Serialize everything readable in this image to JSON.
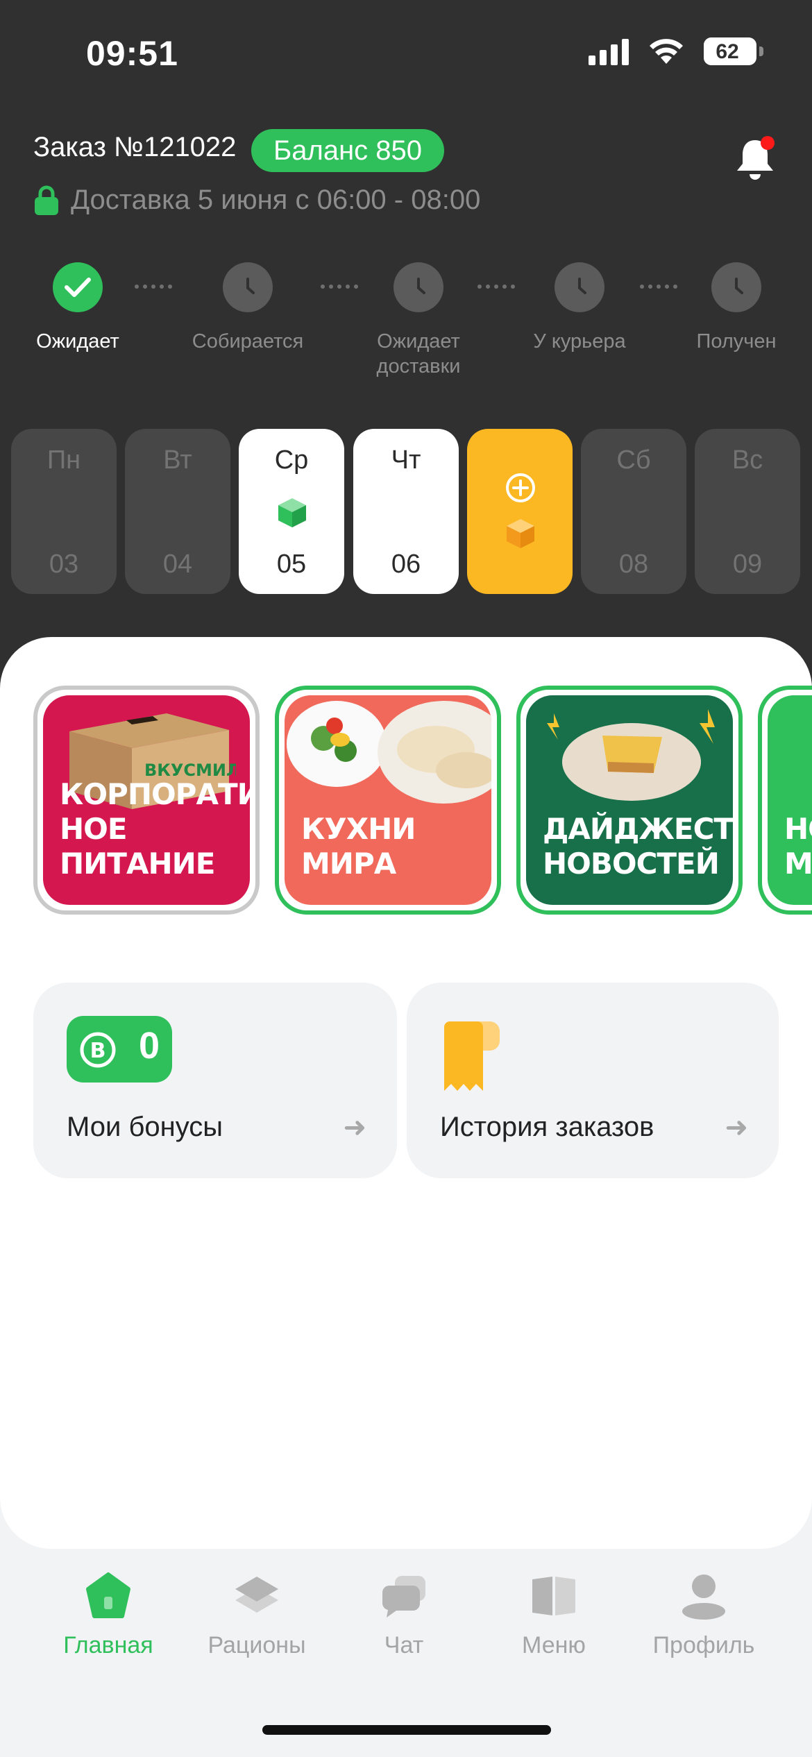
{
  "status_bar": {
    "time": "09:51",
    "battery": "62",
    "battery_level": 0.62
  },
  "header": {
    "order_title": "Заказ №121022",
    "balance": "Баланс 850",
    "delivery": "Доставка 5 июня с 06:00 - 08:00",
    "notification_dot": true
  },
  "tracker": {
    "steps": [
      {
        "label": "Ожидает",
        "state": "done"
      },
      {
        "label": "Собирается",
        "state": "pending"
      },
      {
        "label": "Ожидает доставки",
        "state": "pending"
      },
      {
        "label": "У курьера",
        "state": "pending"
      },
      {
        "label": "Получен",
        "state": "pending"
      }
    ]
  },
  "days": [
    {
      "name": "Пн",
      "num": "03",
      "state": "inactive"
    },
    {
      "name": "Вт",
      "num": "04",
      "state": "inactive"
    },
    {
      "name": "Ср",
      "num": "05",
      "state": "ordered",
      "icon": "green-box-icon"
    },
    {
      "name": "Чт",
      "num": "06",
      "state": "ordered"
    },
    {
      "name": "",
      "num": "",
      "state": "add",
      "icon": "add-circle-icon"
    },
    {
      "name": "Сб",
      "num": "08",
      "state": "inactive"
    },
    {
      "name": "Вс",
      "num": "09",
      "state": "inactive"
    }
  ],
  "stories": [
    {
      "title": "КОРПОРАТИВ НОЕ ПИТАНИЕ",
      "bg": "#d4184f",
      "seen": true,
      "brand": "ВКУСМИЛ"
    },
    {
      "title": "КУХНИ МИРА",
      "bg": "#f0695a",
      "seen": false
    },
    {
      "title": "ДАЙДЖЕСТ НОВОСТЕЙ",
      "bg": "#17704a",
      "seen": false
    },
    {
      "title": "НОВОЕ МЕНЮ",
      "bg": "#2fbf5b",
      "seen": false
    }
  ],
  "tiles": {
    "bonuses": {
      "label": "Мои бонусы",
      "count": "0",
      "letter": "B"
    },
    "history": {
      "label": "История заказов"
    }
  },
  "tabbar": [
    {
      "label": "Главная",
      "icon": "home-icon",
      "active": true
    },
    {
      "label": "Рационы",
      "icon": "layers-icon",
      "active": false
    },
    {
      "label": "Чат",
      "icon": "chat-icon",
      "active": false
    },
    {
      "label": "Меню",
      "icon": "book-icon",
      "active": false
    },
    {
      "label": "Профиль",
      "icon": "user-icon",
      "active": false
    }
  ],
  "colors": {
    "accent": "#2fbf5b",
    "add_day": "#fbb823",
    "dark": "#303030",
    "alert": "#ff1a1a"
  }
}
